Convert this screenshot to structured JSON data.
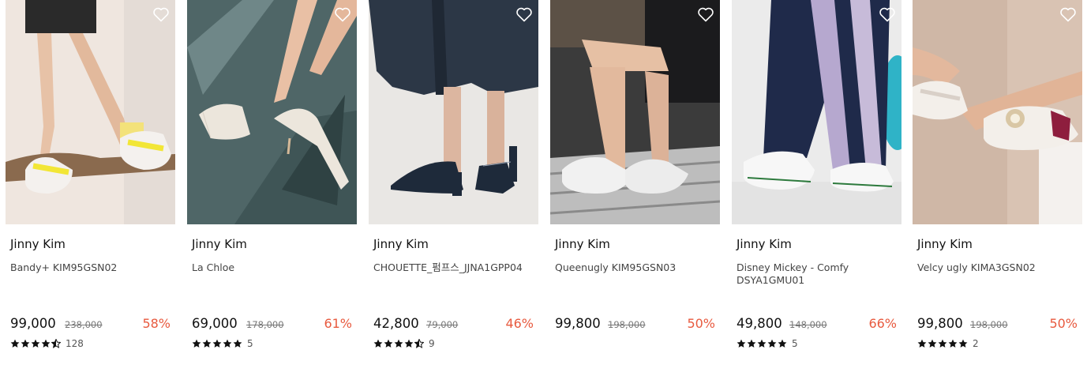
{
  "products": [
    {
      "brand": "Jinny Kim",
      "name": "Bandy+ KIM95GSN02",
      "price": "99,000",
      "original_price": "238,000",
      "discount": "58%",
      "review_count": "128",
      "rating": 4.5,
      "wishlist_icon": "heart-outline-icon"
    },
    {
      "brand": "Jinny Kim",
      "name": "La Chloe",
      "price": "69,000",
      "original_price": "178,000",
      "discount": "61%",
      "review_count": "5",
      "rating": 5,
      "wishlist_icon": "heart-outline-icon"
    },
    {
      "brand": "Jinny Kim",
      "name": "CHOUETTE_펌프스_JJNA1GPP04",
      "price": "42,800",
      "original_price": "79,000",
      "discount": "46%",
      "review_count": "9",
      "rating": 4.5,
      "wishlist_icon": "heart-outline-icon"
    },
    {
      "brand": "Jinny Kim",
      "name": "Queenugly KIM95GSN03",
      "price": "99,800",
      "original_price": "198,000",
      "discount": "50%",
      "review_count": "",
      "rating": 0,
      "wishlist_icon": "heart-outline-icon"
    },
    {
      "brand": "Jinny Kim",
      "name": "Disney Mickey - Comfy DSYA1GMU01",
      "price": "49,800",
      "original_price": "148,000",
      "discount": "66%",
      "review_count": "5",
      "rating": 5,
      "wishlist_icon": "heart-outline-icon"
    },
    {
      "brand": "Jinny Kim",
      "name": "Velcy ugly KIMA3GSN02",
      "price": "99,800",
      "original_price": "198,000",
      "discount": "50%",
      "review_count": "2",
      "rating": 5,
      "wishlist_icon": "heart-outline-icon"
    }
  ],
  "colors": {
    "discount": "#e85a3f",
    "price": "#111111",
    "strike": "#777777",
    "star": "#111111"
  }
}
